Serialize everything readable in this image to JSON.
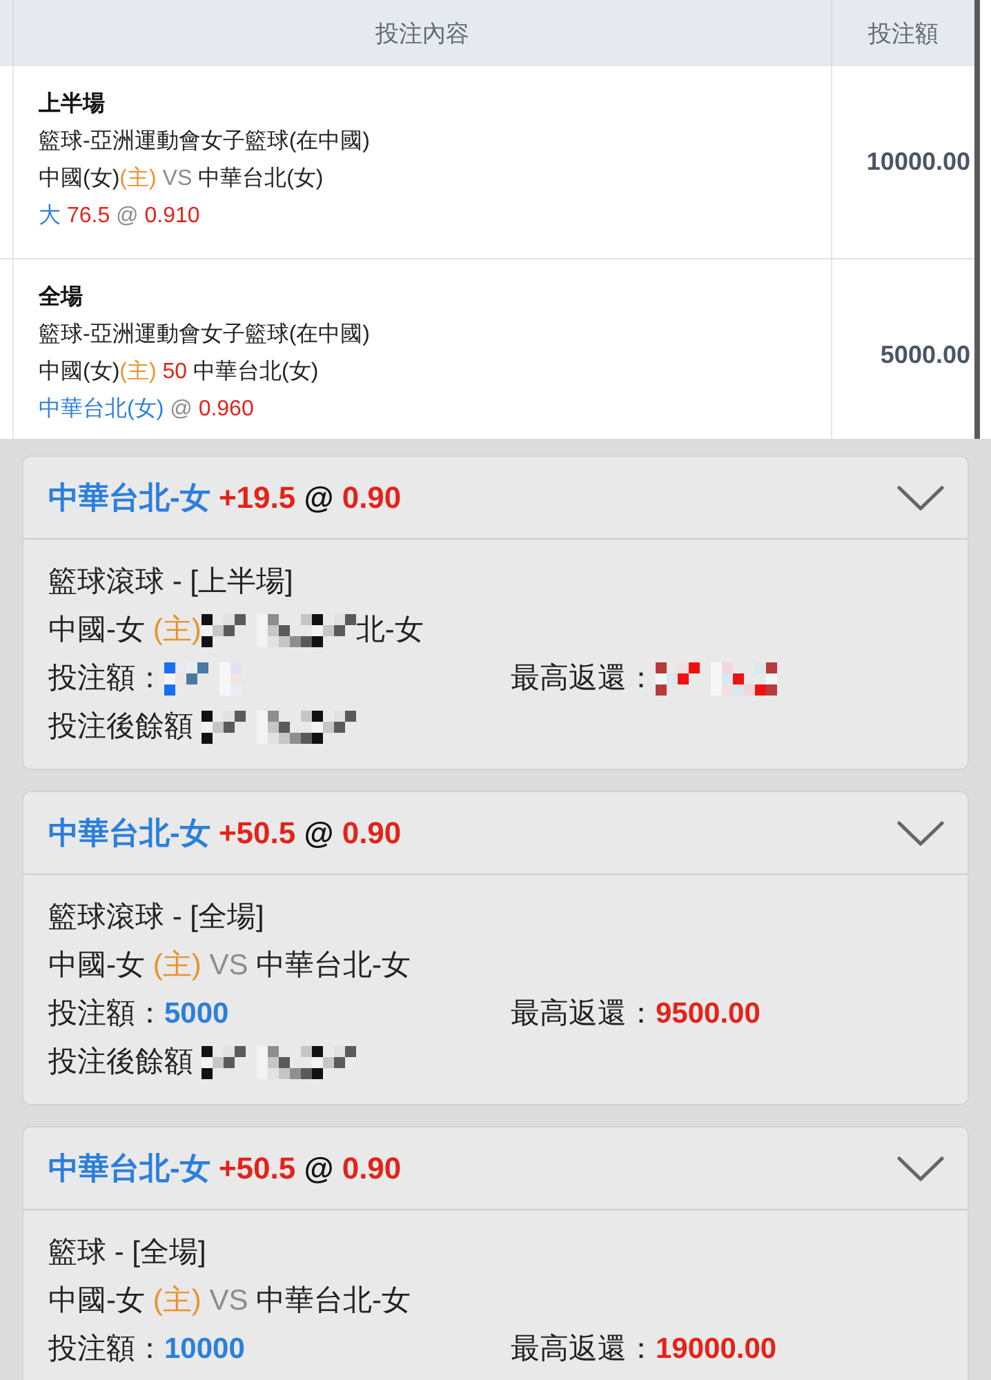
{
  "bet_table": {
    "columns": [
      "投注內容",
      "投注額"
    ],
    "rows": [
      {
        "period": "上半場",
        "lines": [
          [
            [
              {
                "kind": "plain",
                "text": "籃球-亞洲運動會女子籃球(在中國)"
              }
            ]
          ],
          [
            [
              {
                "kind": "plain",
                "text": "中國(女)"
              },
              {
                "kind": "home",
                "text": "(主)"
              }
            ],
            [
              {
                "kind": "muted",
                "text": "VS"
              }
            ],
            [
              {
                "kind": "plain",
                "text": "中華台北(女)"
              }
            ]
          ],
          [
            [
              {
                "kind": "pick",
                "text": "大"
              }
            ],
            [
              {
                "kind": "figure",
                "text": "76.5"
              }
            ],
            [
              {
                "kind": "muted",
                "text": "@"
              }
            ],
            [
              {
                "kind": "figure",
                "text": "0.910"
              }
            ]
          ]
        ],
        "amount": "10000.00"
      },
      {
        "period": "全場",
        "lines": [
          [
            [
              {
                "kind": "plain",
                "text": "籃球-亞洲運動會女子籃球(在中國)"
              }
            ]
          ],
          [
            [
              {
                "kind": "plain",
                "text": "中國(女)"
              },
              {
                "kind": "home",
                "text": "(主)"
              }
            ],
            [
              {
                "kind": "figure",
                "text": "50"
              }
            ],
            [
              {
                "kind": "plain",
                "text": "中華台北(女)"
              }
            ]
          ],
          [
            [
              {
                "kind": "pick",
                "text": "中華台北(女)"
              }
            ],
            [
              {
                "kind": "muted",
                "text": "@"
              }
            ],
            [
              {
                "kind": "figure",
                "text": "0.960"
              }
            ]
          ]
        ],
        "amount": "5000.00"
      }
    ]
  },
  "bet_slips": [
    {
      "header": [
        [
          {
            "kind": "pick",
            "text": "中華台北-女"
          }
        ],
        [
          {
            "kind": "figure",
            "text": "+19.5"
          }
        ],
        [
          {
            "kind": "plain",
            "text": "@"
          }
        ],
        [
          {
            "kind": "figure",
            "text": "0.90"
          }
        ]
      ],
      "rows": [
        {
          "left": [
            [
              {
                "kind": "plain",
                "text": "籃球滾球 - [上半場]"
              }
            ]
          ]
        },
        {
          "left": [
            [
              {
                "kind": "plain",
                "text": "中國-女"
              }
            ],
            [
              {
                "kind": "home",
                "text": "(主)"
              },
              {
                "kind": "plain",
                "redacted": true
              },
              {
                "kind": "plain",
                "text": "北-女"
              }
            ]
          ]
        },
        {
          "left": [
            [
              {
                "kind": "plain",
                "text": "投注額："
              },
              {
                "kind": "pick",
                "redacted": true
              }
            ]
          ],
          "right": [
            [
              {
                "kind": "plain",
                "text": "最高返還："
              },
              {
                "kind": "figure",
                "redacted": true
              }
            ]
          ]
        },
        {
          "left": [
            [
              {
                "kind": "plain",
                "text": "投注後餘額"
              }
            ],
            [
              {
                "kind": "plain",
                "redacted": true
              }
            ]
          ]
        }
      ]
    },
    {
      "header": [
        [
          {
            "kind": "pick",
            "text": "中華台北-女"
          }
        ],
        [
          {
            "kind": "figure",
            "text": "+50.5"
          }
        ],
        [
          {
            "kind": "plain",
            "text": "@"
          }
        ],
        [
          {
            "kind": "figure",
            "text": "0.90"
          }
        ]
      ],
      "rows": [
        {
          "left": [
            [
              {
                "kind": "plain",
                "text": "籃球滾球 - [全場]"
              }
            ]
          ]
        },
        {
          "left": [
            [
              {
                "kind": "plain",
                "text": "中國-女"
              }
            ],
            [
              {
                "kind": "home",
                "text": "(主)"
              }
            ],
            [
              {
                "kind": "muted",
                "text": "VS"
              }
            ],
            [
              {
                "kind": "plain",
                "text": "中華台北-女"
              }
            ]
          ]
        },
        {
          "left": [
            [
              {
                "kind": "plain",
                "text": "投注額："
              },
              {
                "kind": "pick",
                "text": "5000"
              }
            ]
          ],
          "right": [
            [
              {
                "kind": "plain",
                "text": "最高返還："
              },
              {
                "kind": "figure",
                "text": "9500.00"
              }
            ]
          ]
        },
        {
          "left": [
            [
              {
                "kind": "plain",
                "text": "投注後餘額"
              }
            ],
            [
              {
                "kind": "plain",
                "redacted": true
              }
            ]
          ]
        }
      ]
    },
    {
      "header": [
        [
          {
            "kind": "pick",
            "text": "中華台北-女"
          }
        ],
        [
          {
            "kind": "figure",
            "text": "+50.5"
          }
        ],
        [
          {
            "kind": "plain",
            "text": "@"
          }
        ],
        [
          {
            "kind": "figure",
            "text": "0.90"
          }
        ]
      ],
      "rows": [
        {
          "left": [
            [
              {
                "kind": "plain",
                "text": "籃球 - [全場]"
              }
            ]
          ]
        },
        {
          "left": [
            [
              {
                "kind": "plain",
                "text": "中國-女"
              }
            ],
            [
              {
                "kind": "home",
                "text": "(主)"
              }
            ],
            [
              {
                "kind": "muted",
                "text": "VS"
              }
            ],
            [
              {
                "kind": "plain",
                "text": "中華台北-女"
              }
            ]
          ]
        },
        {
          "left": [
            [
              {
                "kind": "plain",
                "text": "投注額："
              },
              {
                "kind": "pick",
                "text": "10000"
              }
            ]
          ],
          "right": [
            [
              {
                "kind": "plain",
                "text": "最高返還："
              },
              {
                "kind": "figure",
                "text": "19000.00"
              }
            ]
          ]
        }
      ]
    }
  ]
}
